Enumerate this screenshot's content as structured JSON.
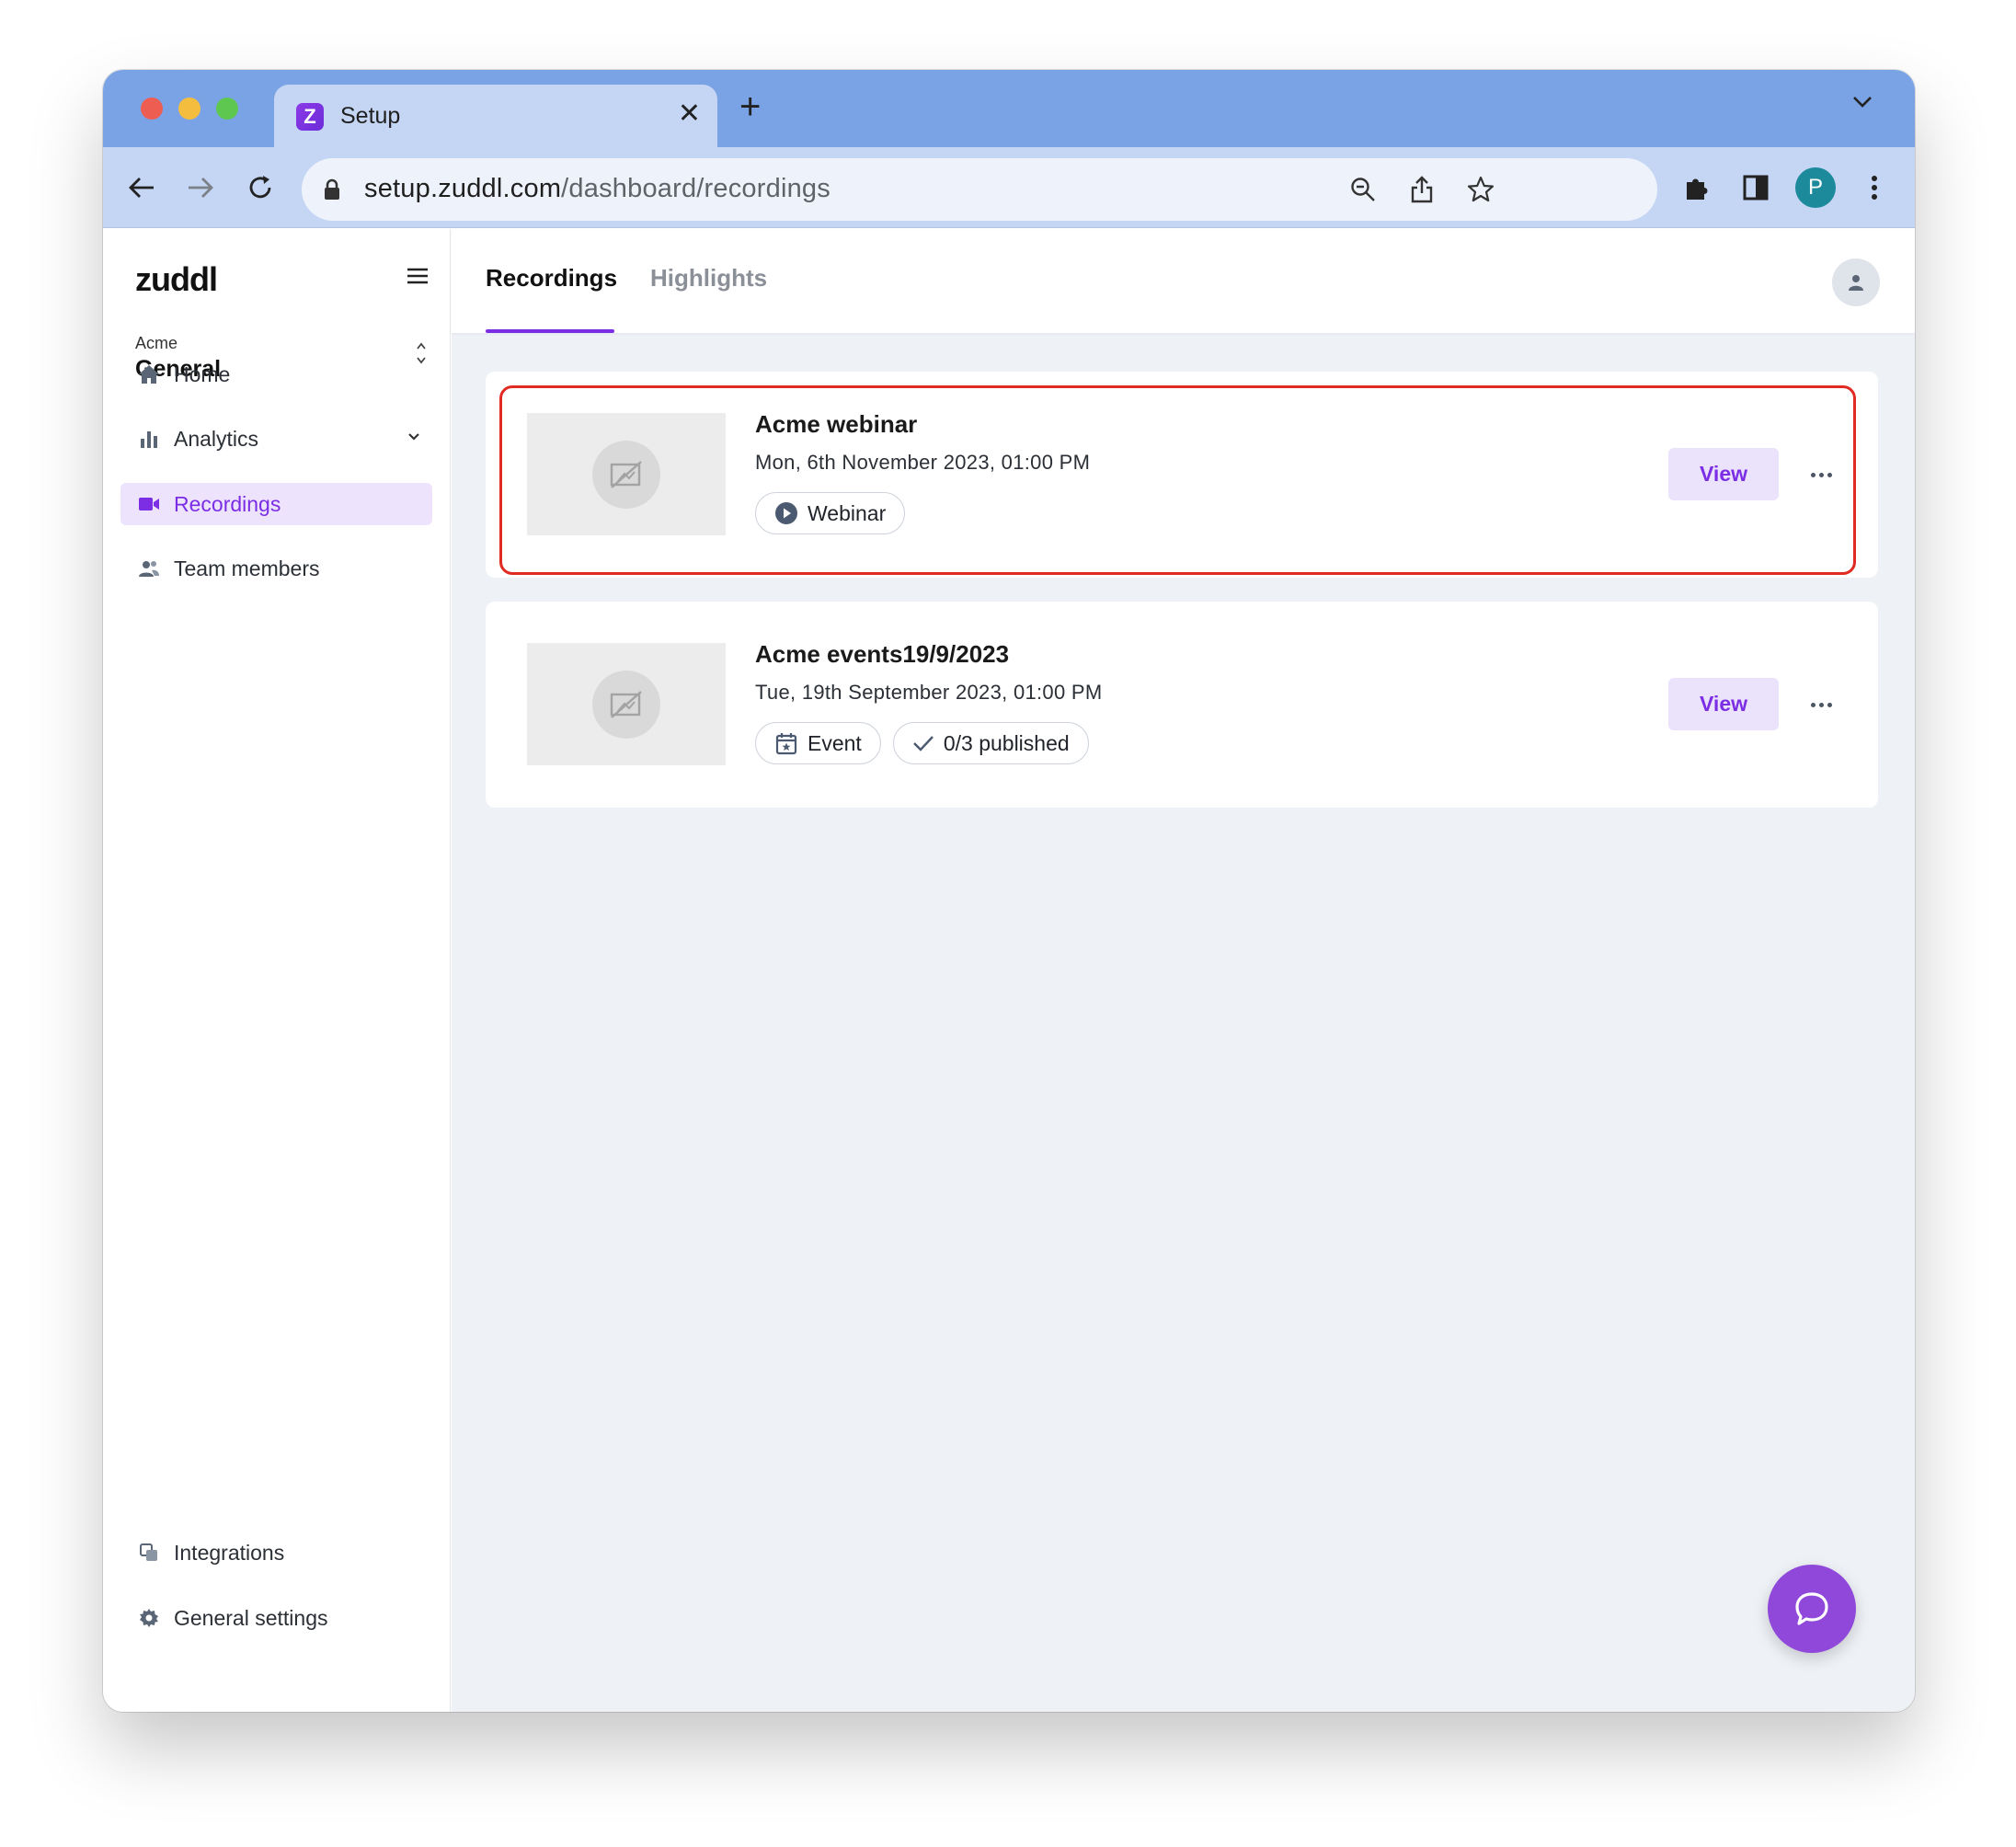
{
  "browser": {
    "tab_title": "Setup",
    "tab_favicon_letter": "Z",
    "url_host": "setup.zuddl.com",
    "url_path": "/dashboard/recordings",
    "profile_initial": "P"
  },
  "sidebar": {
    "logo": "zuddl",
    "org_name": "Acme",
    "workspace": "General",
    "nav": [
      {
        "label": "Home",
        "icon": "home-icon"
      },
      {
        "label": "Analytics",
        "icon": "bar-chart-icon"
      },
      {
        "label": "Recordings",
        "icon": "video-camera-icon",
        "active": true
      },
      {
        "label": "Team members",
        "icon": "people-icon"
      }
    ],
    "bottom_nav": [
      {
        "label": "Integrations",
        "icon": "integrations-icon"
      },
      {
        "label": "General settings",
        "icon": "gear-icon"
      }
    ]
  },
  "header": {
    "tabs": [
      {
        "label": "Recordings",
        "active": true
      },
      {
        "label": "Highlights",
        "active": false
      }
    ]
  },
  "recordings": [
    {
      "title": "Acme webinar",
      "date": "Mon, 6th November 2023, 01:00 PM",
      "chips": [
        {
          "label": "Webinar",
          "icon": "play-circle-icon"
        }
      ],
      "view_label": "View",
      "highlighted": true
    },
    {
      "title": "Acme events19/9/2023",
      "date": "Tue, 19th September 2023, 01:00 PM",
      "chips": [
        {
          "label": "Event",
          "icon": "calendar-star-icon"
        },
        {
          "label": "0/3 published",
          "icon": "check-icon"
        }
      ],
      "view_label": "View",
      "highlighted": false
    }
  ],
  "colors": {
    "accent": "#7b2ee4",
    "accent_light": "#ebe2fb",
    "highlight_outline": "#e02a22",
    "chat_fab": "#8f48d9",
    "tabstrip": "#7aa3e5",
    "toolbar": "#c4d6f3"
  }
}
